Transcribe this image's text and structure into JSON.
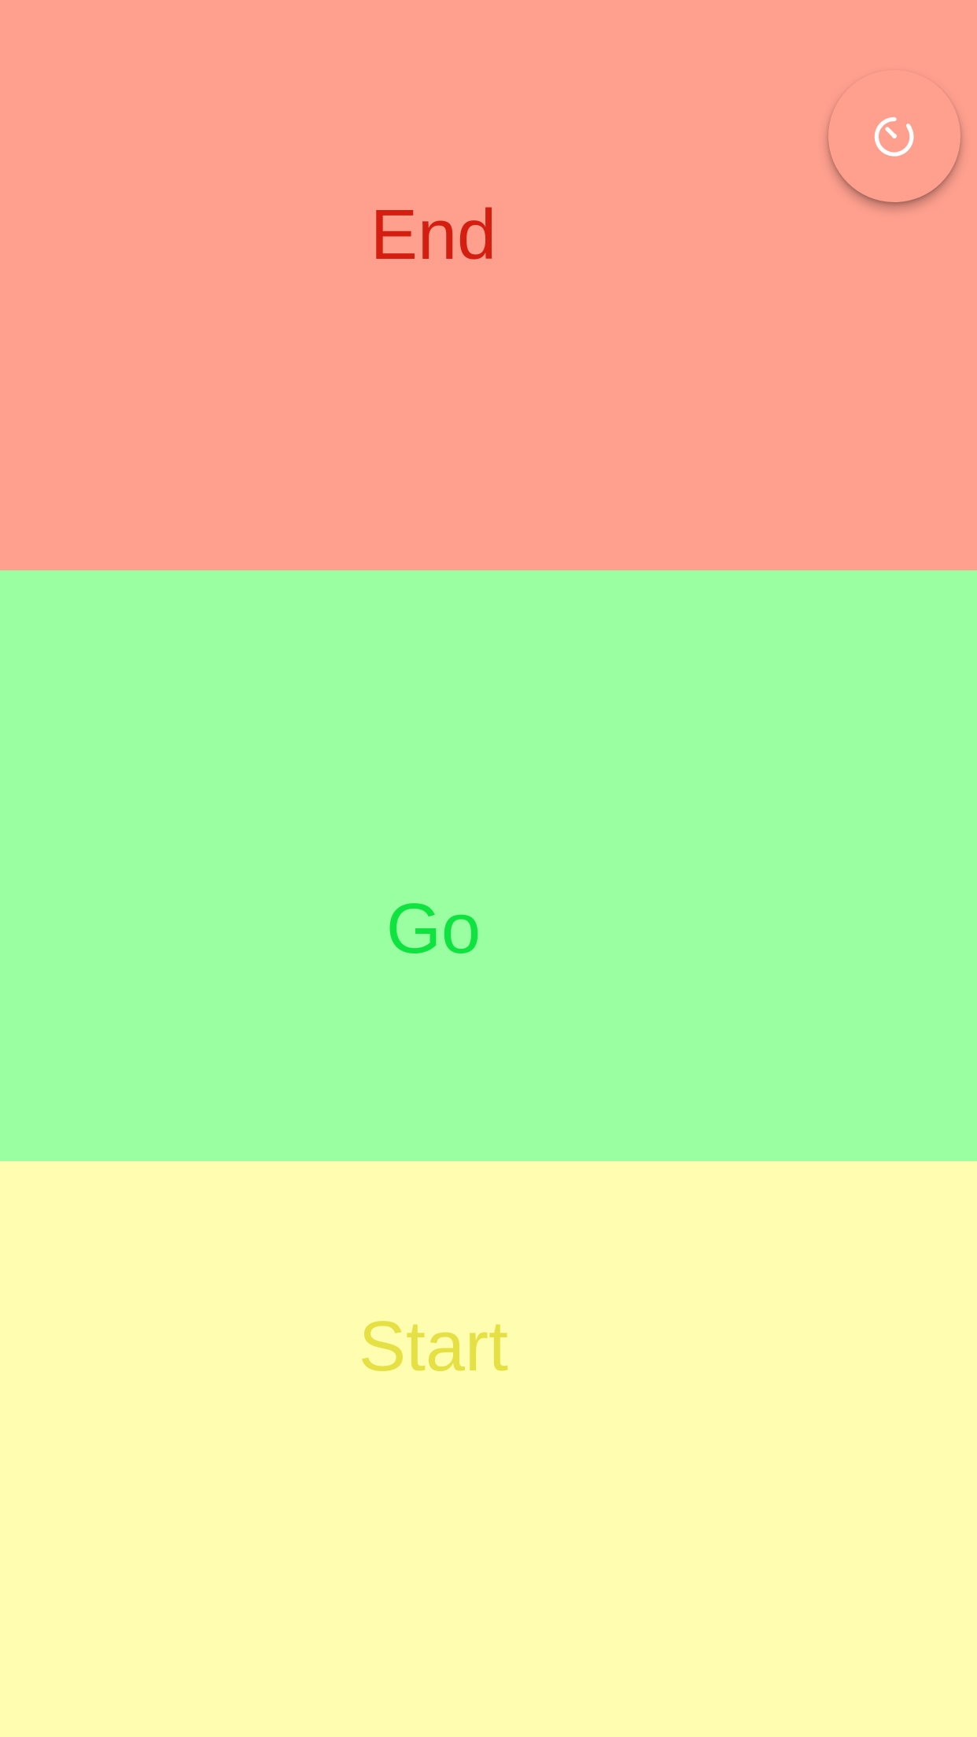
{
  "zones": {
    "end": {
      "label": "End",
      "bg_color": "#ffa08f",
      "text_color": "#d41e10"
    },
    "go": {
      "label": "Go",
      "bg_color": "#99ffa0",
      "text_color": "#0fe340"
    },
    "start": {
      "label": "Start",
      "bg_color": "#fffdb0",
      "text_color": "#e5e145"
    }
  },
  "timer_button": {
    "icon": "stopwatch-icon",
    "bg_color": "#ffa08f",
    "icon_color": "#ffffff"
  }
}
